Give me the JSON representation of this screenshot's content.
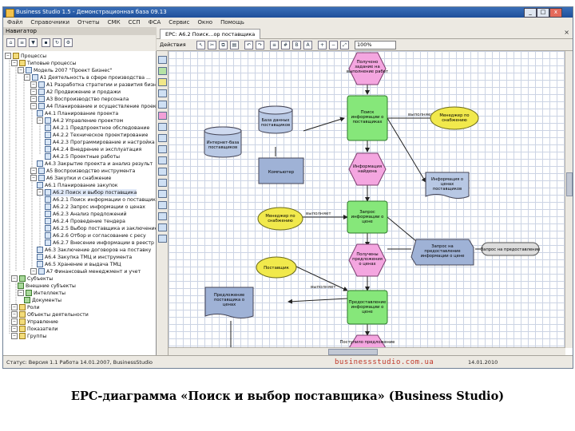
{
  "window": {
    "title": "Business Studio 1.5 - Демонстрационная база 09.13",
    "minimize": "_",
    "maximize": "□",
    "close": "x"
  },
  "menu": [
    "Файл",
    "Справочники",
    "Отчеты",
    "СМК",
    "ССП",
    "ФСА",
    "Сервис",
    "Окно",
    "Помощь"
  ],
  "navigator": {
    "title": "Навигатор",
    "tree": [
      "Процессы",
      "Типовые процессы",
      "Модель 2007 \"Проект Бизнес\"",
      "А1 Деятельность в сфере производства ...",
      "А1 Разработка стратегии и развития бизнеса",
      "А2 Продвижение и продажи",
      "А3 Воспроизводство персонала",
      "А4 Планирование и осуществление проектных",
      "А4.1 Планирование проекта",
      "А4.2 Управление проектом",
      "А4.2.1 Предпроектное обследование",
      "А4.2.2 Техническое проектирование",
      "А4.2.3 Программирование и настройка",
      "А4.2.4 Внедрение и эксплуатация",
      "А4.2.5 Проектные работы",
      "А4.3 Закрытие проекта и анализ результ",
      "А5 Воспроизводство инструмента",
      "А6 Закупки и снабжение",
      "А6.1 Планирование закупок",
      "А6.2 Поиск и выбор поставщика",
      "А6.2.1 Поиск информации о поставщике",
      "А6.2.2 Запрос информации о ценах",
      "А6.2.3 Анализ предложений",
      "А6.2.4 Проведение тендера",
      "А6.2.5 Выбор поставщика и заключение",
      "А6.2.6 Отбор и согласование с ресу",
      "А6.2.7 Внесение информации в реестр",
      "А6.3 Заключение договоров на поставку",
      "А6.4 Закупка ТМЦ и инструмента",
      "А6.5 Хранение и выдача ТМЦ",
      "А7 Финансовый менеджмент и учет",
      "Субъекты",
      "Внешние субъекты",
      "Интеллекты",
      "Документы",
      "Роли",
      "Объекты деятельности",
      "Управление",
      "Показатели",
      "Группы"
    ]
  },
  "document": {
    "tab_label": "EPC: А6.2 Поиск...ор поставщика",
    "close": "×",
    "toolbar_action": "Действия",
    "zoom": "100%"
  },
  "diagram": {
    "events": [
      "Получено задание на выполнение работ",
      "Информация найдена",
      "Получены предложения о ценах",
      "Поступило предложение"
    ],
    "functions": [
      "Поиск информации о поставщиках",
      "Запрос информации о цене",
      "Предоставление информации о цене"
    ],
    "roles": [
      "Менеджер по снабжению",
      "Менеджер по снабжению",
      "Поставщик"
    ],
    "documents": [
      "Информация о ценах поставщиков",
      "Запрос на предоставление информации о цене",
      "Предложение поставщика о ценах"
    ],
    "data_stores": [
      "Интернет-база поставщиков",
      "База данных поставщиков"
    ],
    "systems": [
      "Компьютер"
    ],
    "other": [
      "Запрос на предоставление"
    ],
    "labels": [
      "выполняет",
      "выполняет",
      "выполняет"
    ]
  },
  "status": {
    "text": "Статус: Версия 1.1  Работа 14.01.2007, BusinessStudio",
    "watermark": "businessstudio.com.ua",
    "date": "14.01.2010"
  },
  "caption": "EPC-диаграмма «Поиск и выбор поставщика»  (Business Studio)"
}
